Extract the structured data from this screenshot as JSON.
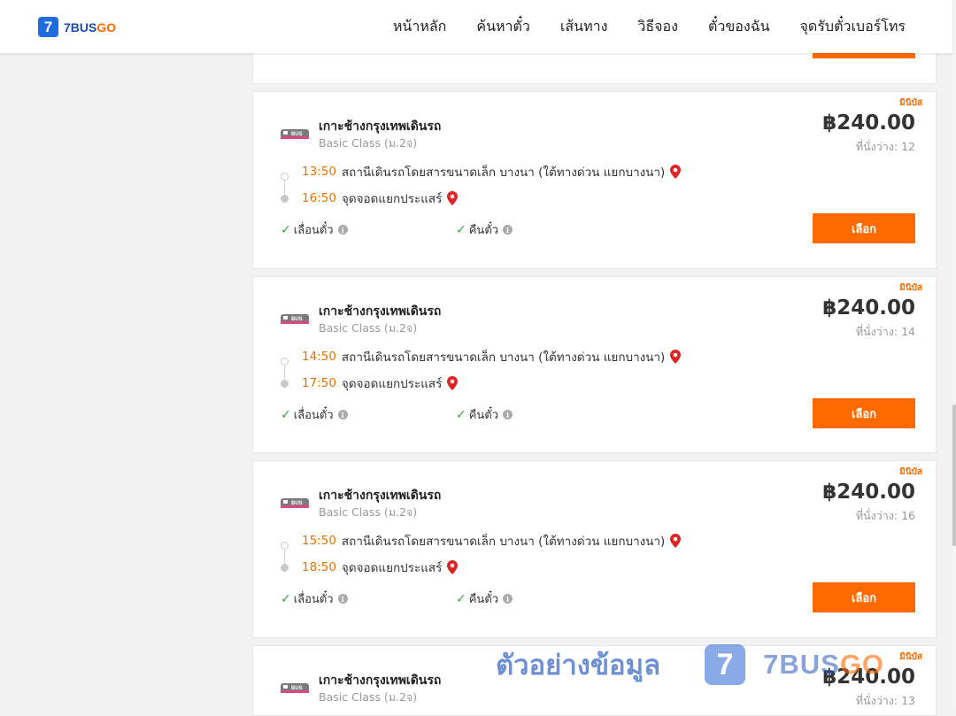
{
  "brand": {
    "logo_mark": "7",
    "name_part1": "7BUS",
    "name_part2": "GO",
    "primary_color": "#1a4db5",
    "accent_color": "#ff6a00"
  },
  "nav": {
    "items": [
      "หน้าหลัก",
      "ค้นหาตั๋ว",
      "เส้นทาง",
      "วิธีจอง",
      "ตั๋วของฉัน",
      "จุดรับตั๋วเบอร์โทร"
    ]
  },
  "trips": [
    {
      "tag": "มินิบัส",
      "operator_name": "เกาะช้างกรุงเทพเดินรถ",
      "service_class": "Basic Class (ม.2จ)",
      "price": "฿240.00",
      "seats": "ที่นั่งว่าง: 12",
      "departure_time": "13:50",
      "departure_place": "สถานีเดินรถโดยสารขนาดเล็ก บางนา (ใต้ทางด่วน แยกบางนา)",
      "arrival_time": "16:50",
      "arrival_place": "จุดจอดแยกประแสร์",
      "feature_change": "เลื่อนตั๋ว",
      "feature_refund": "คืนตั๋ว",
      "select_label": "เลือก"
    },
    {
      "tag": "มินิบัส",
      "operator_name": "เกาะช้างกรุงเทพเดินรถ",
      "service_class": "Basic Class (ม.2จ)",
      "price": "฿240.00",
      "seats": "ที่นั่งว่าง: 14",
      "departure_time": "14:50",
      "departure_place": "สถานีเดินรถโดยสารขนาดเล็ก บางนา (ใต้ทางด่วน แยกบางนา)",
      "arrival_time": "17:50",
      "arrival_place": "จุดจอดแยกประแสร์",
      "feature_change": "เลื่อนตั๋ว",
      "feature_refund": "คืนตั๋ว",
      "select_label": "เลือก"
    },
    {
      "tag": "มินิบัส",
      "operator_name": "เกาะช้างกรุงเทพเดินรถ",
      "service_class": "Basic Class (ม.2จ)",
      "price": "฿240.00",
      "seats": "ที่นั่งว่าง: 16",
      "departure_time": "15:50",
      "departure_place": "สถานีเดินรถโดยสารขนาดเล็ก บางนา (ใต้ทางด่วน แยกบางนา)",
      "arrival_time": "18:50",
      "arrival_place": "จุดจอดแยกประแสร์",
      "feature_change": "เลื่อนตั๋ว",
      "feature_refund": "คืนตั๋ว",
      "select_label": "เลือก"
    },
    {
      "tag": "มินิบัส",
      "operator_name": "เกาะช้างกรุงเทพเดินรถ",
      "service_class": "Basic Class (ม.2จ)",
      "price": "฿240.00",
      "seats": "ที่นั่งว่าง: 13"
    }
  ],
  "watermark": {
    "text": "ตัวอย่างข้อมูล",
    "logo_mark": "7",
    "brand_part1": "7BUS",
    "brand_part2": "GO"
  },
  "icons": {
    "pin": "map-pin-icon",
    "check": "check-icon",
    "info": "info-icon"
  },
  "status_colors": {
    "time": "#e67300",
    "check": "#3aa23a",
    "pin": "#e02424"
  }
}
